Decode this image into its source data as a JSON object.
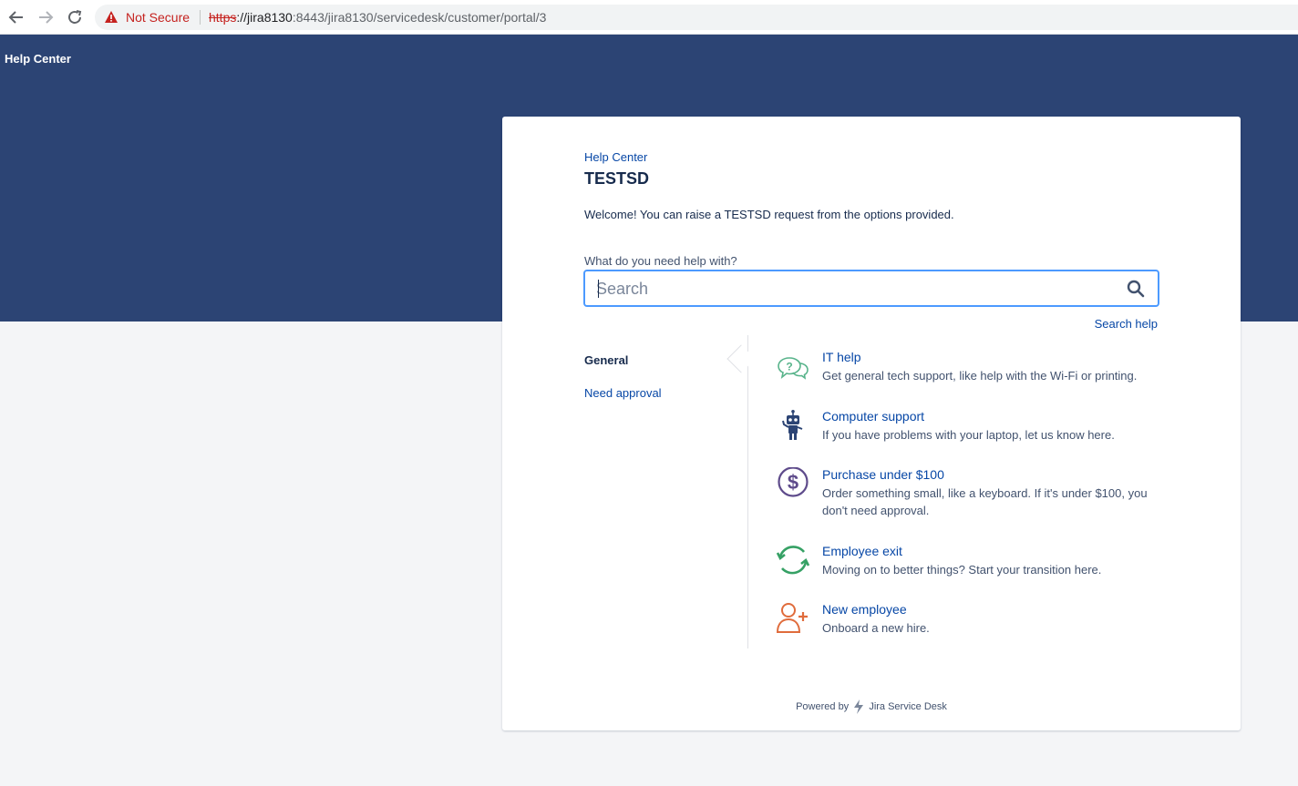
{
  "browser": {
    "security_label": "Not Secure",
    "url_scheme": "https",
    "url_host": "://jira8130",
    "url_rest": ":8443/jira8130/servicedesk/customer/portal/3"
  },
  "header": {
    "title": "Help Center"
  },
  "portal": {
    "breadcrumb": "Help Center",
    "title": "TESTSD",
    "welcome": "Welcome! You can raise a TESTSD request from the options provided."
  },
  "search": {
    "label": "What do you need help with?",
    "placeholder": "Search",
    "help_link": "Search help"
  },
  "groups": [
    {
      "label": "General",
      "selected": true
    },
    {
      "label": "Need approval",
      "selected": false
    }
  ],
  "request_types": [
    {
      "name": "IT help",
      "description": "Get general tech support, like help with the Wi-Fi or printing.",
      "icon": "speech-bubbles-icon"
    },
    {
      "name": "Computer support",
      "description": "If you have problems with your laptop, let us know here.",
      "icon": "robot-icon"
    },
    {
      "name": "Purchase under $100",
      "description": "Order something small, like a keyboard. If it's under $100, you don't need approval.",
      "icon": "dollar-icon"
    },
    {
      "name": "Employee exit",
      "description": "Moving on to better things? Start your transition here.",
      "icon": "cycle-arrows-icon"
    },
    {
      "name": "New employee",
      "description": "Onboard a new hire.",
      "icon": "add-person-icon"
    }
  ],
  "footer": {
    "powered_by": "Powered by",
    "product": "Jira Service Desk"
  },
  "colors": {
    "banner": "#2c4474",
    "link": "#0747a6",
    "focus_border": "#4c9aff"
  }
}
